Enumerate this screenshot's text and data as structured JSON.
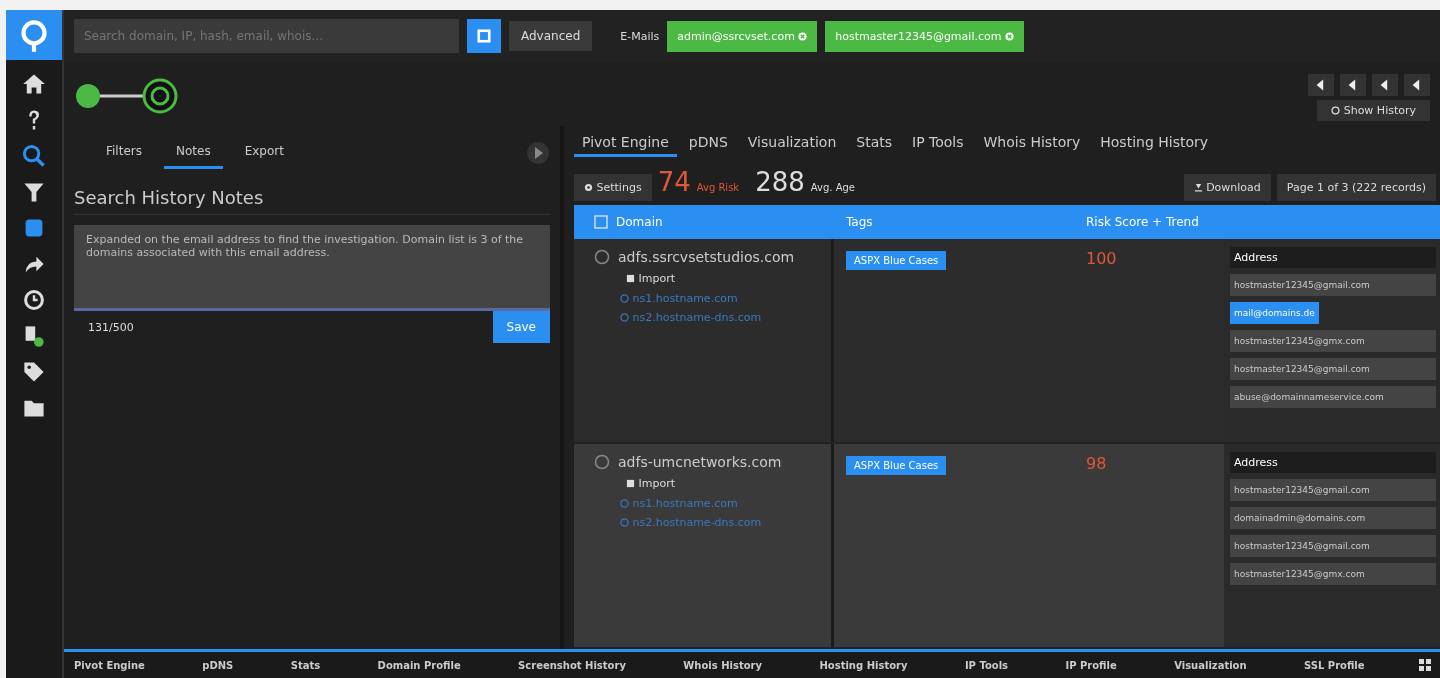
{
  "topbar": {
    "search": {
      "placeholder": "Search domain, IP, hash, email, whois..."
    },
    "advanced": "Advanced",
    "emails_label": "E-Mails",
    "chips": [
      {
        "label": "admin@ssrcvset.com"
      },
      {
        "label": "hostmaster12345@gmail.com"
      }
    ]
  },
  "view_controls": {
    "show_history": "Show History"
  },
  "left_panel": {
    "tabs": [
      {
        "label": "Filters",
        "selected": false
      },
      {
        "label": "Notes",
        "selected": true
      },
      {
        "label": "Export",
        "selected": false
      }
    ],
    "heading": "Search History Notes",
    "note": "Expanded on the email address to find the investigation. Domain list is 3 of the domains associated with this email address.",
    "counter": "131/500",
    "save": "Save"
  },
  "right_panel": {
    "tabs": [
      {
        "label": "Pivot Engine",
        "selected": true
      },
      {
        "label": "pDNS",
        "selected": false
      },
      {
        "label": "Visualization",
        "selected": false
      },
      {
        "label": "Stats",
        "selected": false
      },
      {
        "label": "IP Tools",
        "selected": false
      },
      {
        "label": "Whois History",
        "selected": false
      },
      {
        "label": "Hosting History",
        "selected": false
      }
    ],
    "settings": "Settings",
    "avg_risk": "74",
    "avg_risk_label": "Avg Risk",
    "avg_age": "288",
    "avg_age_label": "Avg. Age",
    "download": "Download",
    "pager": "Page 1 of 3 (222 records)",
    "columns": [
      "Domain",
      "Tags",
      "Risk Score + Trend"
    ],
    "rows": [
      {
        "domain": "adfs.ssrcvsetstudios.com",
        "action": "Import",
        "links": [
          "ns1.hostname.com",
          "ns2.hostname-dns.com"
        ],
        "tag": "ASPX Blue Cases",
        "risk": "100",
        "address_header": "Address",
        "addresses": [
          {
            "text": "hostmaster12345@gmail.com",
            "selected": false
          },
          {
            "text": "mail@domains.de",
            "selected": true
          },
          {
            "text": "hostmaster12345@gmx.com",
            "selected": false
          },
          {
            "text": "hostmaster12345@gmail.com",
            "selected": false
          },
          {
            "text": "abuse@domainnameservice.com",
            "selected": false
          }
        ]
      },
      {
        "domain": "adfs-umcnetworks.com",
        "action": "Import",
        "links": [
          "ns1.hostname.com",
          "ns2.hostname-dns.com"
        ],
        "tag": "ASPX Blue Cases",
        "risk": "98",
        "address_header": "Address",
        "addresses": [
          {
            "text": "hostmaster12345@gmail.com",
            "selected": false
          },
          {
            "text": "domainadmin@domains.com",
            "selected": false
          },
          {
            "text": "hostmaster12345@gmail.com",
            "selected": false
          },
          {
            "text": "hostmaster12345@gmx.com",
            "selected": false
          }
        ]
      }
    ]
  },
  "bottom_tabs": [
    "Pivot Engine",
    "pDNS",
    "Stats",
    "Domain Profile",
    "Screenshot History",
    "Whois History",
    "Hosting History",
    "IP Tools",
    "IP Profile",
    "Visualization",
    "SSL Profile"
  ]
}
